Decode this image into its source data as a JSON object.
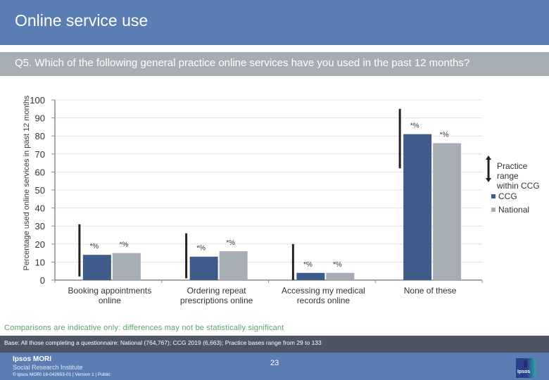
{
  "header": {
    "title": "Online service use",
    "question": "Q5. Which of the following general practice online services have you used in the past 12 months?"
  },
  "chart_data": {
    "type": "bar",
    "title": "",
    "xlabel": "",
    "ylabel": "Percentage used online services in past 12 months",
    "ylim": [
      0,
      100
    ],
    "yticks": [
      0,
      10,
      20,
      30,
      40,
      50,
      60,
      70,
      80,
      90,
      100
    ],
    "grid": true,
    "legend_position": "right",
    "categories": [
      [
        "Booking appointments",
        "online"
      ],
      [
        "Ordering repeat",
        "prescriptions online"
      ],
      [
        "Accessing my medical",
        "records online"
      ],
      [
        "None of these"
      ]
    ],
    "series": [
      {
        "name": "CCG",
        "color": "#3e5b8a",
        "values": [
          14,
          13,
          4,
          81
        ],
        "labels": [
          "*%",
          "*%",
          "*%",
          "*%"
        ]
      },
      {
        "name": "National",
        "color": "#a7adb5",
        "values": [
          15,
          16,
          4,
          76
        ],
        "labels": [
          "*%",
          "*%",
          "*%",
          "*%"
        ]
      }
    ],
    "practice_range": [
      [
        2,
        31
      ],
      [
        1,
        26
      ],
      [
        0,
        20
      ],
      [
        62,
        95
      ]
    ],
    "legend": {
      "range_label": [
        "Practice range",
        "within CCG"
      ],
      "items": [
        "CCG",
        "National"
      ]
    }
  },
  "notes": {
    "comparison": "Comparisons are indicative only: differences may not be statistically significant",
    "base": "Base: All those completing a questionnaire: National (764,767); CCG 2019 (6,663); Practice bases range from 29 to 133"
  },
  "footer": {
    "brand_line1": "Ipsos MORI",
    "brand_line2": "Social Research Institute",
    "legal": "© Ipsos MORI     18-042653-01 | Version 1 | Public",
    "page_number": "23",
    "logo_text": "Ipsos"
  }
}
